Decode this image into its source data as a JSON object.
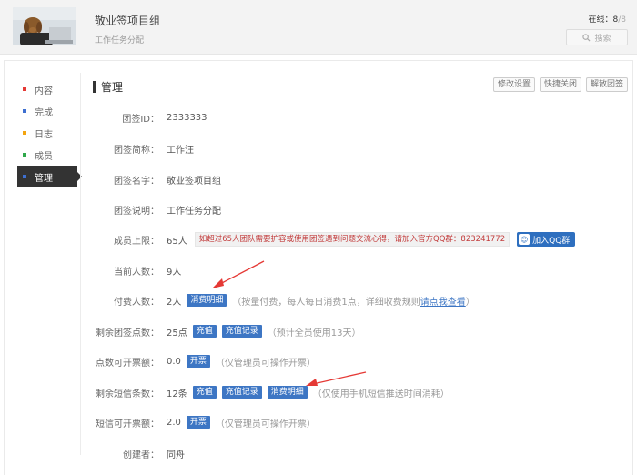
{
  "header": {
    "group_name": "敬业签项目组",
    "group_desc": "工作任务分配",
    "online_label": "在线：",
    "online_count": "8",
    "online_total": "/8",
    "search_label": "搜索",
    "search_icon": "search-icon"
  },
  "sidebar": {
    "items": [
      {
        "label": "内容",
        "color": "#e53935"
      },
      {
        "label": "完成",
        "color": "#3d6fd0"
      },
      {
        "label": "日志",
        "color": "#f3a40f"
      },
      {
        "label": "成员",
        "color": "#2ea84a"
      },
      {
        "label": "管理",
        "color": "#3d6fd0",
        "active": true
      }
    ]
  },
  "main": {
    "title": "管理",
    "buttons": [
      "修改设置",
      "快捷关闭",
      "解散团签"
    ],
    "rows": {
      "id": {
        "label": "团签ID：",
        "value": "2333333"
      },
      "short_name": {
        "label": "团签简称：",
        "value": "工作汪"
      },
      "full_name": {
        "label": "团签名字：",
        "value": "敬业签项目组"
      },
      "desc": {
        "label": "团签说明：",
        "value": "工作任务分配"
      },
      "limit": {
        "label": "成员上限：",
        "value": "65人",
        "notice": "如超过65人团队需要扩容或使用团签遇到问题交流心得，请加入官方QQ群：823241772",
        "qq_button": "加入QQ群"
      },
      "current": {
        "label": "当前人数：",
        "value": "9人"
      },
      "paid": {
        "label": "付费人数：",
        "value": "2人",
        "button": "消费明细",
        "note_prefix": "（按量付费，每人每日消费1点，详细收费规则",
        "note_link": "请点我查看",
        "note_suffix": "）"
      },
      "points": {
        "label": "剩余团签点数：",
        "value": "25点",
        "btn1": "充值",
        "btn2": "充值记录",
        "note": "（预计全员使用13天）"
      },
      "invoice_points": {
        "label": "点数可开票额：",
        "value": "0.0",
        "btn": "开票",
        "note": "（仅管理员可操作开票）"
      },
      "sms": {
        "label": "剩余短信条数：",
        "value": "12条",
        "btn1": "充值",
        "btn2": "充值记录",
        "btn3": "消费明细",
        "note": "（仅使用手机短信推送时间消耗）"
      },
      "invoice_sms": {
        "label": "短信可开票额：",
        "value": "2.0",
        "btn": "开票",
        "note": "（仅管理员可操作开票）"
      },
      "creator": {
        "label": "创建者：",
        "value": "同舟"
      }
    }
  },
  "colors": {
    "accent": "#3d76c4",
    "arrow": "#e53935",
    "notice_text": "#c23b3b"
  }
}
